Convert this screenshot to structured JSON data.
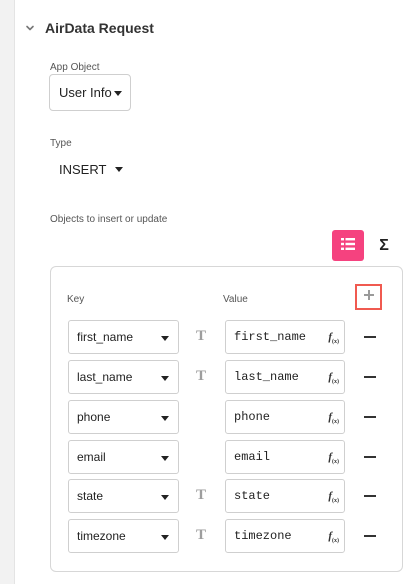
{
  "section": {
    "title": "AirData Request",
    "chevron_icon": "chevron-down-icon"
  },
  "app_object": {
    "label": "App Object",
    "value": "User Info"
  },
  "type": {
    "label": "Type",
    "value": "INSERT"
  },
  "objects": {
    "label": "Objects to insert or update",
    "mode_list_icon": "list-icon",
    "mode_sigma_icon": "sigma-icon",
    "mode_sigma_glyph": "Σ",
    "key_header": "Key",
    "value_header": "Value",
    "add_icon": "plus-icon",
    "text_type_glyph": "T",
    "fx_glyph": "f",
    "fx_sub": "(x)",
    "rows": [
      {
        "key": "first_name",
        "value": "first_name",
        "show_type_icon": true
      },
      {
        "key": "last_name",
        "value": "last_name",
        "show_type_icon": true
      },
      {
        "key": "phone",
        "value": "phone",
        "show_type_icon": false
      },
      {
        "key": "email",
        "value": "email",
        "show_type_icon": false
      },
      {
        "key": "state",
        "value": "state",
        "show_type_icon": true
      },
      {
        "key": "timezone",
        "value": "timezone",
        "show_type_icon": true
      }
    ]
  },
  "colors": {
    "accent_pink": "#f5427f",
    "highlight_red": "#f05a50"
  }
}
